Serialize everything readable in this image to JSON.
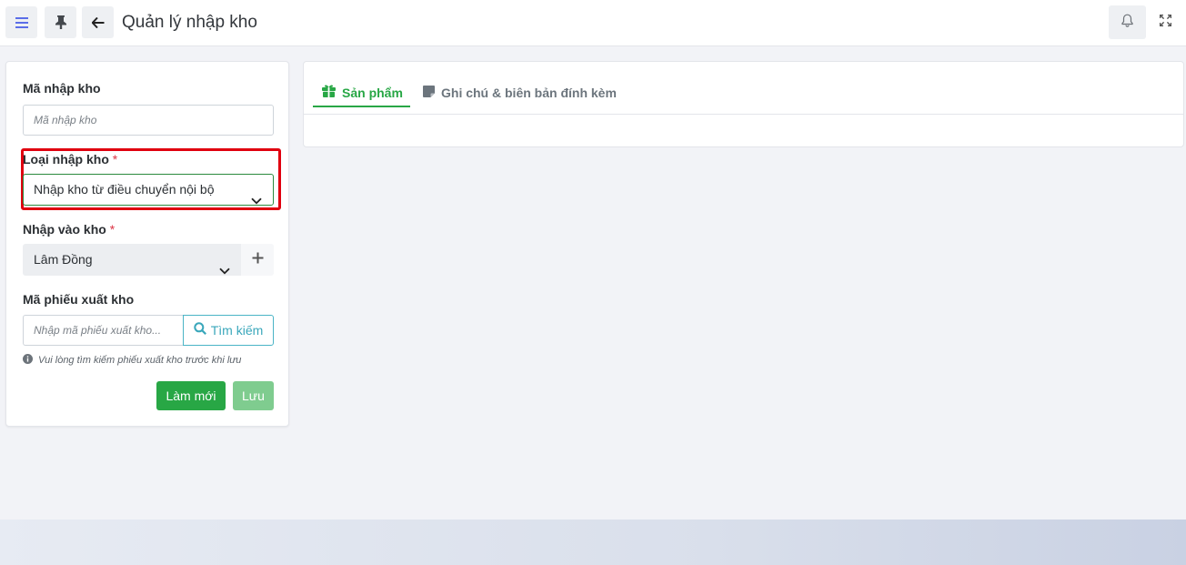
{
  "header": {
    "title": "Quản lý nhập kho",
    "menu_icon": "menu-icon",
    "pin_icon": "pin-icon",
    "back_icon": "arrow-left-icon",
    "bell_icon": "bell-icon",
    "expand_icon": "expand-icon"
  },
  "form": {
    "code_label": "Mã nhập kho",
    "code_placeholder": "Mã nhập kho",
    "type_label": "Loại nhập kho",
    "type_value": "Nhập kho từ điều chuyển nội bộ",
    "warehouse_label": "Nhập vào kho",
    "warehouse_value": "Lâm Đồng",
    "export_code_label": "Mã phiếu xuất kho",
    "export_code_placeholder": "Nhập mã phiếu xuất kho...",
    "search_label": "Tìm kiếm",
    "hint": "Vui lòng tìm kiếm phiếu xuất kho trước khi lưu",
    "required_mark": "*",
    "new_label": "Làm mới",
    "save_label": "Lưu"
  },
  "tabs": [
    {
      "label": "Sản phẩm",
      "icon": "box-icon",
      "active": true
    },
    {
      "label": "Ghi chú & biên bản đính kèm",
      "icon": "note-icon",
      "active": false
    }
  ],
  "colors": {
    "accent_green": "#28a745",
    "accent_blue": "#5b6ee8",
    "search_teal": "#3aa7bb",
    "highlight_red": "#e0000f",
    "required_red": "#dc3545"
  }
}
